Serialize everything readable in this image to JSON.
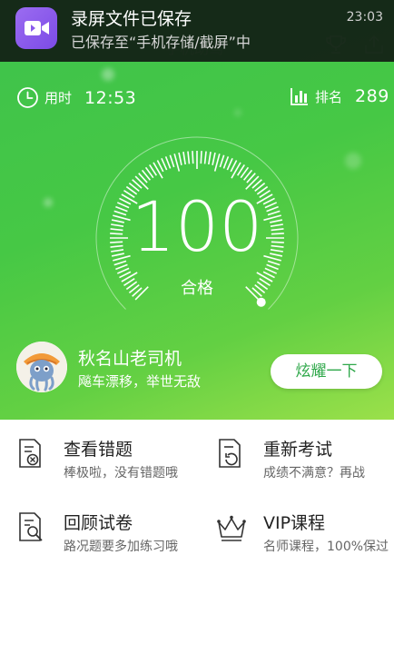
{
  "notification": {
    "title": "录屏文件已保存",
    "subtitle": "已保存至“手机存储/截屏”中",
    "time": "23:03",
    "icon": "video-camera-icon"
  },
  "stats": {
    "time_label": "用时",
    "time_value": "12:53",
    "rank_label": "排名",
    "rank_value": "289"
  },
  "result": {
    "score": "100",
    "grade": "合格",
    "gauge_fill_percent": 100
  },
  "user": {
    "name": "秋名山老司机",
    "motto": "飚车漂移，举世无敌",
    "share_label": "炫耀一下"
  },
  "actions": [
    {
      "title": "查看错题",
      "subtitle": "棒极啦，没有错题哦",
      "icon": "wrong-answers-icon"
    },
    {
      "title": "重新考试",
      "subtitle": "成绩不满意？再战",
      "icon": "retake-exam-icon"
    },
    {
      "title": "回顾试卷",
      "subtitle": "路况题要多加练习哦",
      "icon": "review-paper-icon"
    },
    {
      "title": "VIP课程",
      "subtitle": "名师课程，100%保过",
      "icon": "vip-crown-icon"
    }
  ],
  "colors": {
    "hero_green": "#46c845",
    "accent_green": "#2fa84a",
    "notification_bg": "#121e14",
    "app_icon_purple": "#8a5aec"
  }
}
